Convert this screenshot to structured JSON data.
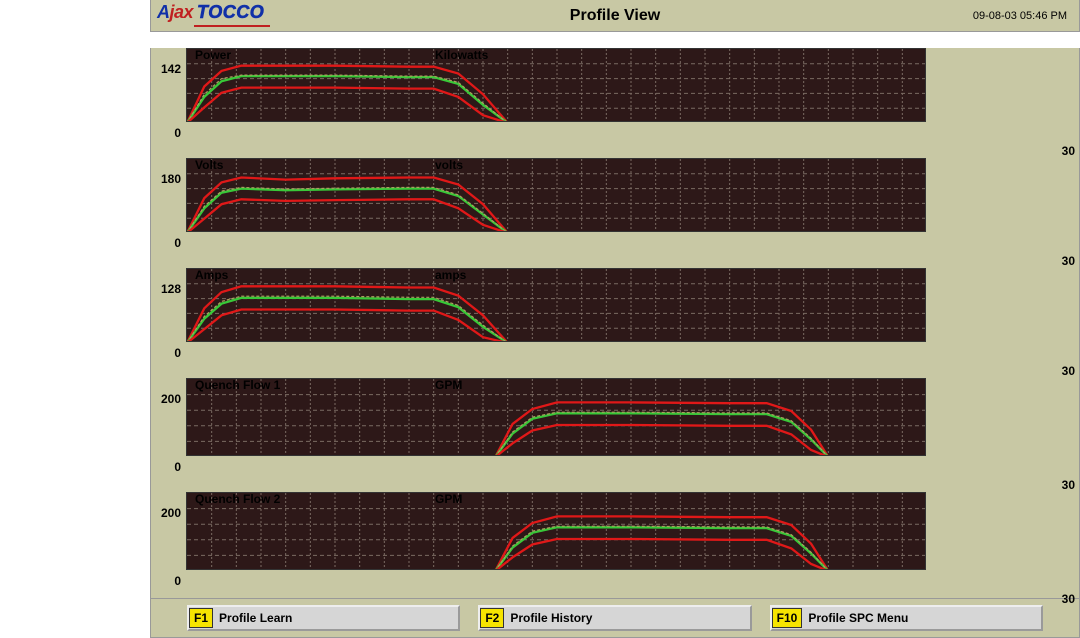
{
  "header": {
    "logo_ajax": "Ajax",
    "logo_tocco": "TOCCO",
    "title": "Profile View",
    "datetime": "09-08-03  05:46 PM"
  },
  "footer": {
    "f1_key": "F1",
    "f1_label": "Profile Learn",
    "f2_key": "F2",
    "f2_label": "Profile History",
    "f10_key": "F10",
    "f10_label": "Profile SPC Menu"
  },
  "chart_data": [
    {
      "type": "line",
      "name": "Power",
      "unit": "Kilowatts",
      "ylim": [
        0,
        142
      ],
      "xlim": [
        0,
        30
      ],
      "x": [
        0,
        0.7,
        1.4,
        2.2,
        6,
        9,
        10,
        11,
        12,
        13
      ],
      "series": [
        {
          "name": "upper",
          "color": "#e01818",
          "values": [
            0,
            70,
            100,
            110,
            110,
            108,
            108,
            95,
            55,
            0
          ]
        },
        {
          "name": "actual",
          "color": "#38c838",
          "values": [
            0,
            50,
            80,
            90,
            90,
            88,
            88,
            75,
            35,
            0
          ]
        },
        {
          "name": "nominal",
          "color": "#aaa060",
          "values": [
            0,
            55,
            85,
            92,
            92,
            90,
            90,
            78,
            38,
            0
          ]
        },
        {
          "name": "lower",
          "color": "#e01818",
          "values": [
            0,
            30,
            58,
            68,
            68,
            66,
            66,
            50,
            15,
            0
          ]
        }
      ]
    },
    {
      "type": "line",
      "name": "Volts",
      "unit": "volts",
      "ylim": [
        0,
        180
      ],
      "xlim": [
        0,
        30
      ],
      "x": [
        0,
        0.7,
        1.4,
        2.2,
        4,
        6,
        9,
        10,
        11,
        12,
        13
      ],
      "series": [
        {
          "name": "upper",
          "color": "#e01818",
          "values": [
            0,
            85,
            123,
            135,
            130,
            133,
            135,
            135,
            118,
            70,
            0
          ]
        },
        {
          "name": "actual",
          "color": "#38c838",
          "values": [
            0,
            60,
            98,
            108,
            104,
            106,
            108,
            108,
            90,
            45,
            0
          ]
        },
        {
          "name": "nominal",
          "color": "#aaa060",
          "values": [
            0,
            65,
            102,
            111,
            107,
            109,
            111,
            111,
            93,
            48,
            0
          ]
        },
        {
          "name": "lower",
          "color": "#e01818",
          "values": [
            0,
            35,
            70,
            82,
            78,
            80,
            82,
            82,
            60,
            20,
            0
          ]
        }
      ]
    },
    {
      "type": "line",
      "name": "Amps",
      "unit": "amps",
      "ylim": [
        0,
        128
      ],
      "xlim": [
        0,
        30
      ],
      "x": [
        0,
        0.7,
        1.4,
        2.2,
        6,
        9,
        10,
        11,
        12,
        13
      ],
      "series": [
        {
          "name": "upper",
          "color": "#e01818",
          "values": [
            0,
            60,
            88,
            98,
            98,
            96,
            96,
            82,
            48,
            0
          ]
        },
        {
          "name": "actual",
          "color": "#38c838",
          "values": [
            0,
            42,
            68,
            78,
            78,
            76,
            76,
            62,
            28,
            0
          ]
        },
        {
          "name": "nominal",
          "color": "#aaa060",
          "values": [
            0,
            46,
            72,
            81,
            81,
            79,
            79,
            65,
            31,
            0
          ]
        },
        {
          "name": "lower",
          "color": "#e01818",
          "values": [
            0,
            24,
            48,
            58,
            58,
            56,
            56,
            40,
            10,
            0
          ]
        }
      ]
    },
    {
      "type": "line",
      "name": "Quench Flow 1",
      "unit": "GPM",
      "ylim": [
        0,
        200
      ],
      "xlim": [
        0,
        30
      ],
      "x": [
        12.5,
        13.2,
        14.0,
        15.0,
        18,
        22,
        23.5,
        24.5,
        25.3,
        26.0
      ],
      "series": [
        {
          "name": "upper",
          "color": "#e01818",
          "values": [
            0,
            85,
            123,
            140,
            140,
            138,
            138,
            118,
            70,
            0
          ]
        },
        {
          "name": "actual",
          "color": "#38c838",
          "values": [
            0,
            60,
            98,
            112,
            112,
            110,
            110,
            90,
            45,
            0
          ]
        },
        {
          "name": "nominal",
          "color": "#aaa060",
          "values": [
            0,
            64,
            102,
            115,
            115,
            113,
            113,
            93,
            48,
            0
          ]
        },
        {
          "name": "lower",
          "color": "#e01818",
          "values": [
            0,
            35,
            68,
            82,
            82,
            80,
            80,
            58,
            18,
            0
          ]
        }
      ]
    },
    {
      "type": "line",
      "name": "Quench Flow 2",
      "unit": "GPM",
      "ylim": [
        0,
        200
      ],
      "xlim": [
        0,
        30
      ],
      "x": [
        12.5,
        13.2,
        14.0,
        15.0,
        18,
        22,
        23.5,
        24.5,
        25.3,
        26.0
      ],
      "series": [
        {
          "name": "upper",
          "color": "#e01818",
          "values": [
            0,
            85,
            123,
            140,
            140,
            138,
            138,
            118,
            70,
            0
          ]
        },
        {
          "name": "actual",
          "color": "#38c838",
          "values": [
            0,
            60,
            98,
            112,
            112,
            110,
            110,
            90,
            45,
            0
          ]
        },
        {
          "name": "nominal",
          "color": "#aaa060",
          "values": [
            0,
            64,
            102,
            115,
            115,
            113,
            113,
            93,
            48,
            0
          ]
        },
        {
          "name": "lower",
          "color": "#e01818",
          "values": [
            0,
            35,
            68,
            82,
            82,
            80,
            80,
            58,
            18,
            0
          ]
        }
      ]
    }
  ]
}
